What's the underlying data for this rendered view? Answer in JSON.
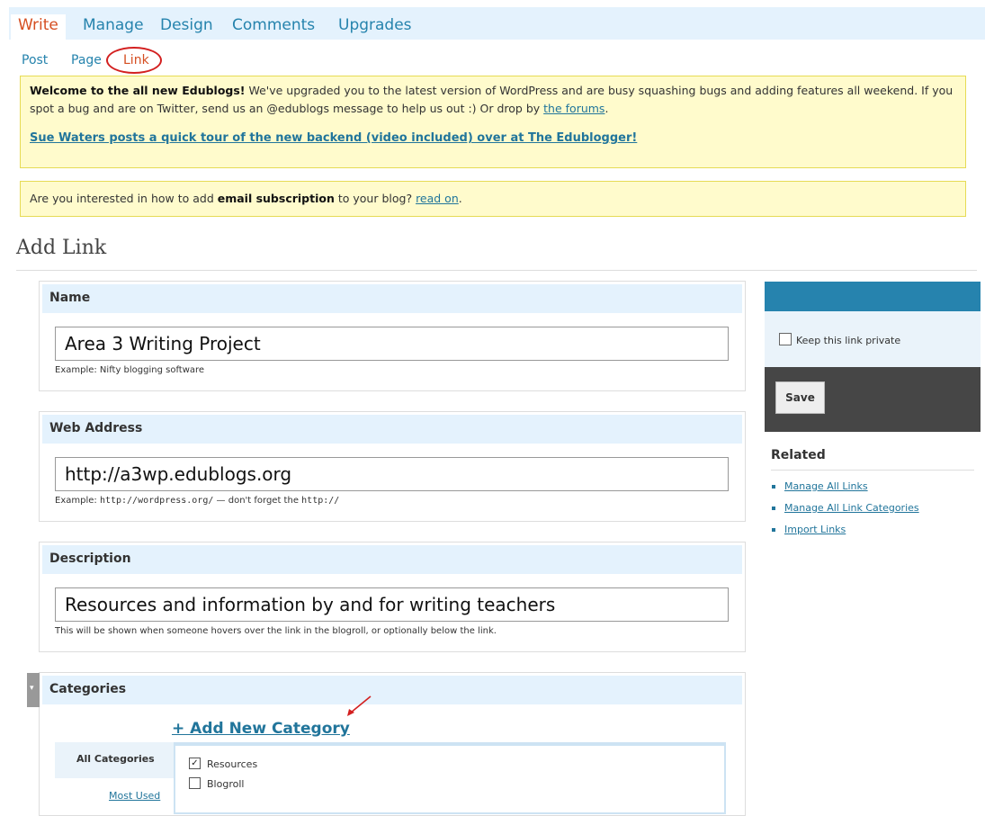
{
  "nav": {
    "tabs": [
      "Write",
      "Manage",
      "Design",
      "Comments",
      "Upgrades"
    ],
    "sub": [
      "Post",
      "Page",
      "Link"
    ]
  },
  "notice1": {
    "bold": "Welcome to the all new Edublogs!",
    "text": " We've upgraded you to the latest version of WordPress and are busy squashing bugs and adding features all weekend. If you spot a bug and are on Twitter, send us an @edublogs message to help us out :) Or drop by ",
    "link": "the forums",
    "end": ".",
    "big_link": "Sue Waters posts a quick tour of the new backend (video included) over at The Edublogger!"
  },
  "notice2": {
    "pre": "Are you interested in how to add ",
    "bold": "email subscription",
    "mid": " to your blog? ",
    "link": "read on",
    "end": "."
  },
  "page_title": "Add Link",
  "name_box": {
    "label": "Name",
    "value": "Area 3 Writing Project",
    "hint": "Example: Nifty blogging software"
  },
  "web_box": {
    "label": "Web Address",
    "value": "http://a3wp.edublogs.org",
    "hint_pre": "Example: ",
    "hint_code1": "http://wordpress.org/",
    "hint_mid": " — don't forget the ",
    "hint_code2": "http://"
  },
  "desc_box": {
    "label": "Description",
    "value": "Resources and information by and for writing teachers",
    "hint": "This will be shown when someone hovers over the link in the blogroll, or optionally below the link."
  },
  "categories": {
    "label": "Categories",
    "add_new": "+ Add New Category",
    "tab_all": "All Categories",
    "tab_most": "Most Used",
    "items": [
      {
        "label": "Resources",
        "checked": true
      },
      {
        "label": "Blogroll",
        "checked": false
      }
    ]
  },
  "sidebar": {
    "private_label": "Keep this link private",
    "save": "Save",
    "related_title": "Related",
    "related": [
      "Manage All Links",
      "Manage All Link Categories",
      "Import Links"
    ]
  },
  "colors": {
    "accent": "#21759b",
    "active_tab": "#d54e21",
    "notice_bg": "#fffbcc",
    "annotation": "#d32020"
  }
}
